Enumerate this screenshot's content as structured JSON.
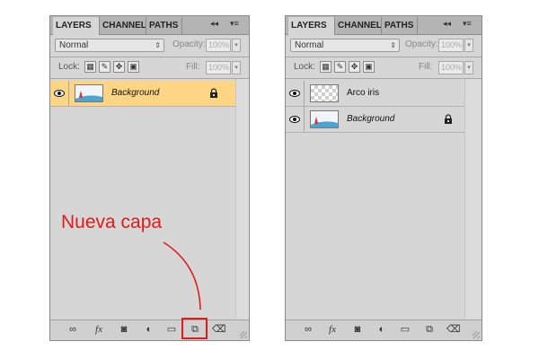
{
  "panels": [
    {
      "tabs": [
        "LAYERS",
        "CHANNELS",
        "PATHS"
      ],
      "blend_mode": "Normal",
      "opacity_label": "Opacity:",
      "opacity_value": "100%",
      "lock_label": "Lock:",
      "fill_label": "Fill:",
      "fill_value": "100%",
      "layers": [
        {
          "name": "Background",
          "selected": true,
          "locked": true,
          "thumb": "image"
        }
      ]
    },
    {
      "tabs": [
        "LAYERS",
        "CHANNELS",
        "PATHS"
      ],
      "blend_mode": "Normal",
      "opacity_label": "Opacity:",
      "opacity_value": "100%",
      "lock_label": "Lock:",
      "fill_label": "Fill:",
      "fill_value": "100%",
      "layers": [
        {
          "name": "Arco iris",
          "selected": false,
          "locked": false,
          "thumb": "transparent"
        },
        {
          "name": "Background",
          "selected": false,
          "locked": true,
          "thumb": "image"
        }
      ]
    }
  ],
  "annotation": {
    "text": "Nueva capa",
    "color": "#e31a1a",
    "target_icon": "new-layer-icon"
  },
  "colors": {
    "panel_bg": "#d6d6d6",
    "selected_layer": "#fed584",
    "annotation": "#e31a1a"
  },
  "icons": {
    "collapse": "double-left-arrow-icon",
    "menu": "panel-menu-icon",
    "eye": "eye-icon",
    "lock": "lock-icon",
    "bottom": [
      "link-icon",
      "fx-icon",
      "mask-icon",
      "adjustment-icon",
      "folder-icon",
      "new-layer-icon",
      "trash-icon"
    ]
  }
}
